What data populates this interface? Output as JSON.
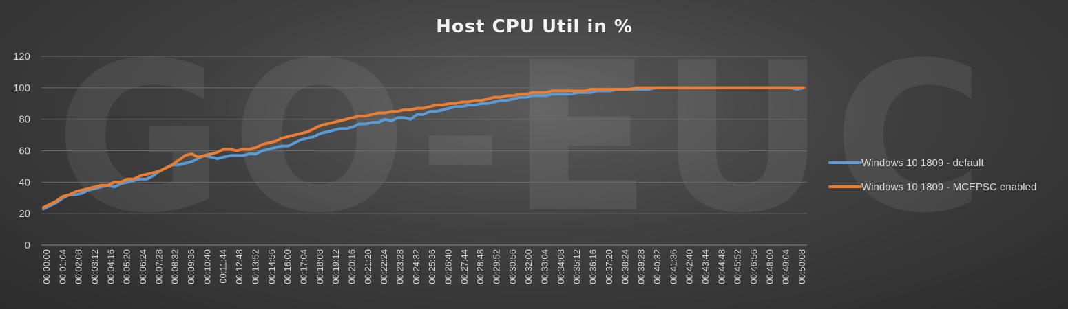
{
  "watermark_text": "GO-EUC",
  "chart_data": {
    "type": "line",
    "title": "Host CPU Util in %",
    "ylim": [
      0,
      120
    ],
    "yticks": [
      0,
      20,
      40,
      60,
      80,
      100,
      120
    ],
    "grid": true,
    "legend_position": "right",
    "x_tick_labels": [
      "00:00:00",
      "00:01:04",
      "00:02:08",
      "00:03:12",
      "00:04:16",
      "00:05:20",
      "00:06:24",
      "00:07:28",
      "00:08:32",
      "00:09:36",
      "00:10:40",
      "00:11:44",
      "00:12:48",
      "00:13:52",
      "00:14:56",
      "00:16:00",
      "00:17:04",
      "00:18:08",
      "00:19:12",
      "00:20:16",
      "00:21:20",
      "00:22:24",
      "00:23:28",
      "00:24:32",
      "00:25:36",
      "00:26:40",
      "00:27:44",
      "00:28:48",
      "00:29:52",
      "00:30:56",
      "00:32:00",
      "00:33:04",
      "00:34:08",
      "00:35:12",
      "00:36:16",
      "00:37:20",
      "00:38:24",
      "00:39:28",
      "00:40:32",
      "00:41:36",
      "00:42:40",
      "00:43:44",
      "00:44:48",
      "00:45:52",
      "00:46:56",
      "00:48:00",
      "00:49:04",
      "00:50:08"
    ],
    "x_tick_labels_rotated_text_note": "",
    "series": [
      {
        "name": "Windows 10 1809 - default",
        "color": "#5b9bd5",
        "values": [
          23,
          25,
          27,
          30,
          32,
          32,
          33,
          35,
          36,
          37,
          38,
          37,
          39,
          40,
          41,
          42,
          42,
          44,
          47,
          49,
          51,
          51,
          52,
          53,
          55,
          57,
          56,
          55,
          56,
          57,
          57,
          57,
          58,
          58,
          60,
          61,
          62,
          63,
          63,
          65,
          67,
          68,
          69,
          71,
          72,
          73,
          74,
          74,
          75,
          77,
          77,
          78,
          78,
          80,
          79,
          81,
          81,
          80,
          83,
          83,
          85,
          85,
          86,
          87,
          88,
          88,
          89,
          89,
          90,
          90,
          91,
          92,
          92,
          93,
          94,
          94,
          95,
          95,
          95,
          96,
          96,
          96,
          96,
          97,
          97,
          97,
          98,
          98,
          98,
          99,
          99,
          99,
          99,
          99,
          99,
          100,
          100,
          100,
          100,
          100,
          100,
          100,
          100,
          100,
          100,
          100,
          100,
          100,
          100,
          100,
          100,
          100,
          100,
          100,
          100,
          100,
          100,
          99,
          100
        ]
      },
      {
        "name": "Windows 10 1809 - MCEPSC enabled",
        "color": "#ed7d31",
        "values": [
          24,
          26,
          28,
          31,
          32,
          34,
          35,
          36,
          37,
          38,
          38,
          40,
          40,
          42,
          42,
          44,
          45,
          46,
          47,
          49,
          51,
          54,
          57,
          58,
          56,
          57,
          58,
          59,
          61,
          61,
          60,
          61,
          61,
          62,
          64,
          65,
          66,
          68,
          69,
          70,
          71,
          72,
          74,
          76,
          77,
          78,
          79,
          80,
          81,
          82,
          82,
          83,
          84,
          84,
          85,
          85,
          86,
          86,
          87,
          87,
          88,
          89,
          89,
          90,
          90,
          91,
          91,
          92,
          92,
          93,
          94,
          94,
          95,
          95,
          96,
          96,
          97,
          97,
          97,
          98,
          98,
          98,
          98,
          98,
          98,
          99,
          99,
          99,
          99,
          99,
          99,
          99,
          100,
          100,
          100,
          100,
          100,
          100,
          100,
          100,
          100,
          100,
          100,
          100,
          100,
          100,
          100,
          100,
          100,
          100,
          100,
          100,
          100,
          100,
          100,
          100,
          100,
          100,
          100
        ]
      }
    ]
  }
}
